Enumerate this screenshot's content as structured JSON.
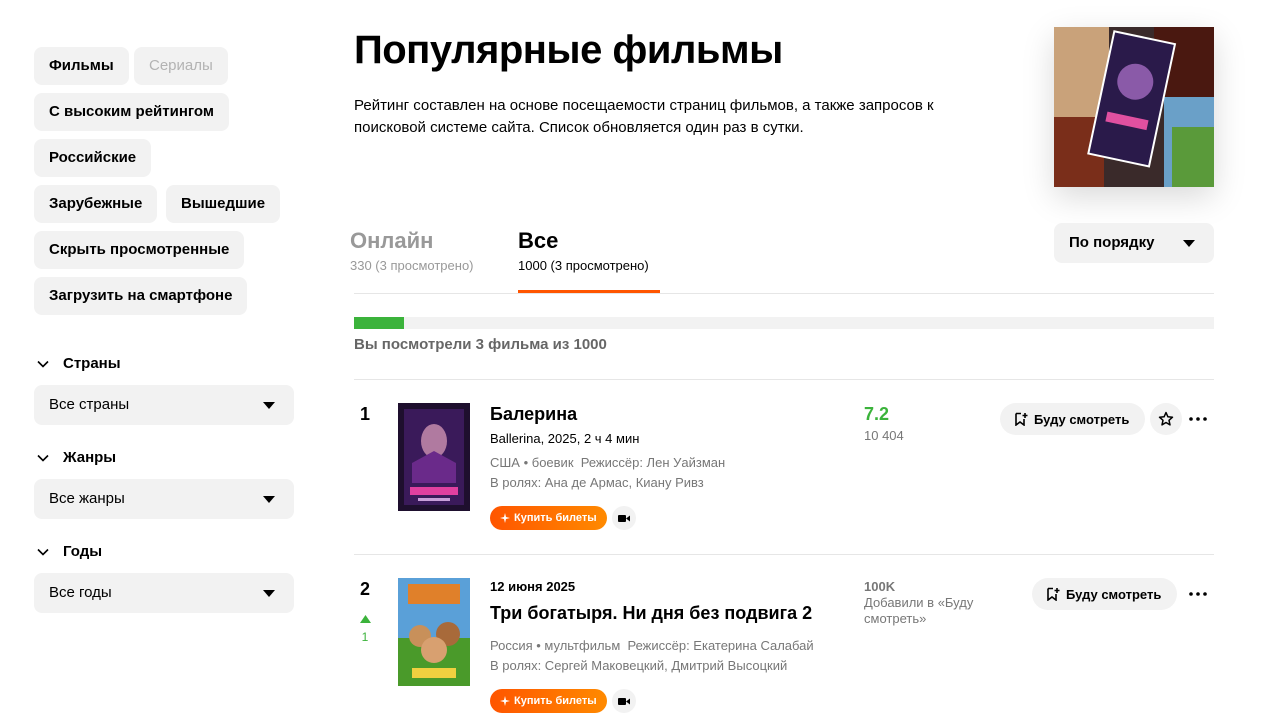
{
  "sidebar": {
    "chips": {
      "films": "Фильмы",
      "series": "Сериалы",
      "high_rating": "С высоким рейтингом",
      "russian": "Российские",
      "foreign": "Зарубежные",
      "released": "Вышедшие",
      "hide_watched": "Скрыть просмотренные",
      "download_phone": "Загрузить на смартфоне"
    },
    "filters": {
      "countries_label": "Страны",
      "countries_value": "Все страны",
      "genres_label": "Жанры",
      "genres_value": "Все жанры",
      "years_label": "Годы",
      "years_value": "Все годы"
    }
  },
  "header": {
    "title": "Популярные фильмы",
    "description": "Рейтинг составлен на основе посещаемости страниц фильмов, а также запросов к поисковой системе сайта. Список обновляется один раз в сутки."
  },
  "tabs": {
    "online": {
      "label": "Онлайн",
      "sub": "330 (3 просмотрено)"
    },
    "all": {
      "label": "Все",
      "sub": "1000 (3 просмотрено)"
    }
  },
  "sort": {
    "value": "По порядку"
  },
  "progress": {
    "watched": 3,
    "total": 1000,
    "fill_fraction": 0.058,
    "text": "Вы посмотрели 3 фильма из 1000"
  },
  "films": [
    {
      "rank": "1",
      "title": "Балерина",
      "subtitle": "Ballerina, 2025, 2 ч 4 мин",
      "meta": "США • боевик  Режиссёр: Лен Уайзман",
      "cast": "В ролях: Ана де Армас, Киану Ривз",
      "buy_label": "Купить билеты",
      "rating": "7.2",
      "votes": "10 404",
      "watch_label": "Буду смотреть"
    },
    {
      "rank": "2",
      "rank_delta": "1",
      "release_date": "12 июня 2025",
      "title": "Три богатыря. Ни дня без подвига 2",
      "meta": "Россия • мультфильм  Режиссёр: Екатерина Салабай",
      "cast": "В ролях: Сергей Маковецкий, Дмитрий Высоцкий",
      "buy_label": "Купить билеты",
      "wait_count": "100K",
      "wait_label": "Добавили в «Буду смотреть»",
      "watch_label": "Буду смотреть"
    }
  ],
  "colors": {
    "accent_orange": "#ff5500",
    "rating_green": "#3bb33b",
    "chip_bg": "#f2f2f2"
  },
  "icons": {
    "chevron": "chevron-down-icon",
    "bookmark_plus": "bookmark-plus-icon",
    "star": "star-icon",
    "more": "more-dots-icon",
    "camera": "video-camera-icon",
    "spark": "spark-icon"
  }
}
